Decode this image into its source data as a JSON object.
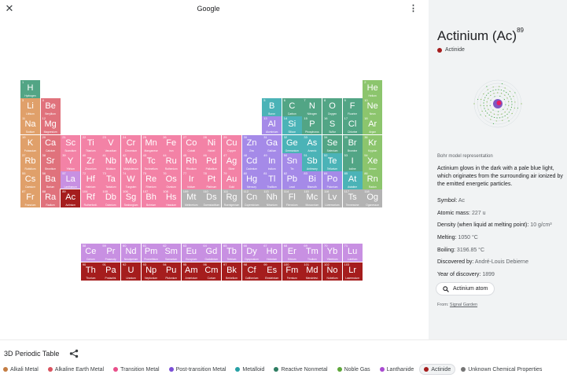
{
  "topbar": {
    "title": "Google"
  },
  "palette": {
    "alkali": "#e0a06a",
    "alkaline": "#e0727c",
    "transition": "#f382a6",
    "post": "#a58ae8",
    "metalloid": "#4bb3b7",
    "nonmetal": "#52a585",
    "noble": "#8cc56d",
    "lanthanide": "#c890e2",
    "actinide": "#a51d1d",
    "unknown": "#b3b3b3"
  },
  "elements": [
    {
      "n": "1",
      "s": "H",
      "name": "Hydrogen",
      "c": "nonmetal",
      "p": 1,
      "g": 1
    },
    {
      "n": "2",
      "s": "He",
      "name": "Helium",
      "c": "noble",
      "p": 1,
      "g": 18
    },
    {
      "n": "3",
      "s": "Li",
      "name": "Lithium",
      "c": "alkali",
      "p": 2,
      "g": 1
    },
    {
      "n": "4",
      "s": "Be",
      "name": "Beryllium",
      "c": "alkaline",
      "p": 2,
      "g": 2
    },
    {
      "n": "5",
      "s": "B",
      "name": "Boron",
      "c": "metalloid",
      "p": 2,
      "g": 13
    },
    {
      "n": "6",
      "s": "C",
      "name": "Carbon",
      "c": "nonmetal",
      "p": 2,
      "g": 14
    },
    {
      "n": "7",
      "s": "N",
      "name": "Nitrogen",
      "c": "nonmetal",
      "p": 2,
      "g": 15
    },
    {
      "n": "8",
      "s": "O",
      "name": "Oxygen",
      "c": "nonmetal",
      "p": 2,
      "g": 16
    },
    {
      "n": "9",
      "s": "F",
      "name": "Fluorine",
      "c": "nonmetal",
      "p": 2,
      "g": 17
    },
    {
      "n": "10",
      "s": "Ne",
      "name": "Neon",
      "c": "noble",
      "p": 2,
      "g": 18
    },
    {
      "n": "11",
      "s": "Na",
      "name": "Sodium",
      "c": "alkali",
      "p": 3,
      "g": 1
    },
    {
      "n": "12",
      "s": "Mg",
      "name": "Magnesium",
      "c": "alkaline",
      "p": 3,
      "g": 2
    },
    {
      "n": "13",
      "s": "Al",
      "name": "Aluminium",
      "c": "post",
      "p": 3,
      "g": 13
    },
    {
      "n": "14",
      "s": "Si",
      "name": "Silicon",
      "c": "metalloid",
      "p": 3,
      "g": 14
    },
    {
      "n": "15",
      "s": "P",
      "name": "Phosphorus",
      "c": "nonmetal",
      "p": 3,
      "g": 15
    },
    {
      "n": "16",
      "s": "S",
      "name": "Sulfur",
      "c": "nonmetal",
      "p": 3,
      "g": 16
    },
    {
      "n": "17",
      "s": "Cl",
      "name": "Chlorine",
      "c": "nonmetal",
      "p": 3,
      "g": 17
    },
    {
      "n": "18",
      "s": "Ar",
      "name": "Argon",
      "c": "noble",
      "p": 3,
      "g": 18
    },
    {
      "n": "19",
      "s": "K",
      "name": "Potassium",
      "c": "alkali",
      "p": 4,
      "g": 1
    },
    {
      "n": "20",
      "s": "Ca",
      "name": "Calcium",
      "c": "alkaline",
      "p": 4,
      "g": 2
    },
    {
      "n": "21",
      "s": "Sc",
      "name": "Scandium",
      "c": "transition",
      "p": 4,
      "g": 3
    },
    {
      "n": "22",
      "s": "Ti",
      "name": "Titanium",
      "c": "transition",
      "p": 4,
      "g": 4
    },
    {
      "n": "23",
      "s": "V",
      "name": "Vanadium",
      "c": "transition",
      "p": 4,
      "g": 5
    },
    {
      "n": "24",
      "s": "Cr",
      "name": "Chromium",
      "c": "transition",
      "p": 4,
      "g": 6
    },
    {
      "n": "25",
      "s": "Mn",
      "name": "Manganese",
      "c": "transition",
      "p": 4,
      "g": 7
    },
    {
      "n": "26",
      "s": "Fe",
      "name": "Iron",
      "c": "transition",
      "p": 4,
      "g": 8
    },
    {
      "n": "27",
      "s": "Co",
      "name": "Cobalt",
      "c": "transition",
      "p": 4,
      "g": 9
    },
    {
      "n": "28",
      "s": "Ni",
      "name": "Nickel",
      "c": "transition",
      "p": 4,
      "g": 10
    },
    {
      "n": "29",
      "s": "Cu",
      "name": "Copper",
      "c": "transition",
      "p": 4,
      "g": 11
    },
    {
      "n": "30",
      "s": "Zn",
      "name": "Zinc",
      "c": "post",
      "p": 4,
      "g": 12
    },
    {
      "n": "31",
      "s": "Ga",
      "name": "Gallium",
      "c": "post",
      "p": 4,
      "g": 13
    },
    {
      "n": "32",
      "s": "Ge",
      "name": "Germanium",
      "c": "metalloid",
      "p": 4,
      "g": 14
    },
    {
      "n": "33",
      "s": "As",
      "name": "Arsenic",
      "c": "metalloid",
      "p": 4,
      "g": 15
    },
    {
      "n": "34",
      "s": "Se",
      "name": "Selenium",
      "c": "nonmetal",
      "p": 4,
      "g": 16
    },
    {
      "n": "35",
      "s": "Br",
      "name": "Bromine",
      "c": "nonmetal",
      "p": 4,
      "g": 17
    },
    {
      "n": "36",
      "s": "Kr",
      "name": "Krypton",
      "c": "noble",
      "p": 4,
      "g": 18
    },
    {
      "n": "37",
      "s": "Rb",
      "name": "Rubidium",
      "c": "alkali",
      "p": 5,
      "g": 1
    },
    {
      "n": "38",
      "s": "Sr",
      "name": "Strontium",
      "c": "alkaline",
      "p": 5,
      "g": 2
    },
    {
      "n": "39",
      "s": "Y",
      "name": "Yttrium",
      "c": "transition",
      "p": 5,
      "g": 3
    },
    {
      "n": "40",
      "s": "Zr",
      "name": "Zirconium",
      "c": "transition",
      "p": 5,
      "g": 4
    },
    {
      "n": "41",
      "s": "Nb",
      "name": "Niobium",
      "c": "transition",
      "p": 5,
      "g": 5
    },
    {
      "n": "42",
      "s": "Mo",
      "name": "Molybdenum",
      "c": "transition",
      "p": 5,
      "g": 6
    },
    {
      "n": "43",
      "s": "Tc",
      "name": "Technetium",
      "c": "transition",
      "p": 5,
      "g": 7
    },
    {
      "n": "44",
      "s": "Ru",
      "name": "Ruthenium",
      "c": "transition",
      "p": 5,
      "g": 8
    },
    {
      "n": "45",
      "s": "Rh",
      "name": "Rhodium",
      "c": "transition",
      "p": 5,
      "g": 9
    },
    {
      "n": "46",
      "s": "Pd",
      "name": "Palladium",
      "c": "transition",
      "p": 5,
      "g": 10
    },
    {
      "n": "47",
      "s": "Ag",
      "name": "Silver",
      "c": "transition",
      "p": 5,
      "g": 11
    },
    {
      "n": "48",
      "s": "Cd",
      "name": "Cadmium",
      "c": "post",
      "p": 5,
      "g": 12
    },
    {
      "n": "49",
      "s": "In",
      "name": "Indium",
      "c": "post",
      "p": 5,
      "g": 13
    },
    {
      "n": "50",
      "s": "Sn",
      "name": "Tin",
      "c": "post",
      "p": 5,
      "g": 14
    },
    {
      "n": "51",
      "s": "Sb",
      "name": "Antimony",
      "c": "metalloid",
      "p": 5,
      "g": 15
    },
    {
      "n": "52",
      "s": "Te",
      "name": "Tellurium",
      "c": "metalloid",
      "p": 5,
      "g": 16
    },
    {
      "n": "53",
      "s": "I",
      "name": "Iodine",
      "c": "nonmetal",
      "p": 5,
      "g": 17
    },
    {
      "n": "54",
      "s": "Xe",
      "name": "Xenon",
      "c": "noble",
      "p": 5,
      "g": 18
    },
    {
      "n": "55",
      "s": "Cs",
      "name": "Caesium",
      "c": "alkali",
      "p": 6,
      "g": 1
    },
    {
      "n": "56",
      "s": "Ba",
      "name": "Barium",
      "c": "alkaline",
      "p": 6,
      "g": 2
    },
    {
      "n": "57",
      "s": "La",
      "name": "Lanthanum",
      "c": "lanthanide",
      "p": 6,
      "g": 3
    },
    {
      "n": "72",
      "s": "Hf",
      "name": "Hafnium",
      "c": "transition",
      "p": 6,
      "g": 4
    },
    {
      "n": "73",
      "s": "Ta",
      "name": "Tantalum",
      "c": "transition",
      "p": 6,
      "g": 5
    },
    {
      "n": "74",
      "s": "W",
      "name": "Tungsten",
      "c": "transition",
      "p": 6,
      "g": 6
    },
    {
      "n": "75",
      "s": "Re",
      "name": "Rhenium",
      "c": "transition",
      "p": 6,
      "g": 7
    },
    {
      "n": "76",
      "s": "Os",
      "name": "Osmium",
      "c": "transition",
      "p": 6,
      "g": 8
    },
    {
      "n": "77",
      "s": "Ir",
      "name": "Iridium",
      "c": "transition",
      "p": 6,
      "g": 9
    },
    {
      "n": "78",
      "s": "Pt",
      "name": "Platinum",
      "c": "transition",
      "p": 6,
      "g": 10
    },
    {
      "n": "79",
      "s": "Au",
      "name": "Gold",
      "c": "transition",
      "p": 6,
      "g": 11
    },
    {
      "n": "80",
      "s": "Hg",
      "name": "Mercury",
      "c": "post",
      "p": 6,
      "g": 12
    },
    {
      "n": "81",
      "s": "Tl",
      "name": "Thallium",
      "c": "post",
      "p": 6,
      "g": 13
    },
    {
      "n": "82",
      "s": "Pb",
      "name": "Lead",
      "c": "post",
      "p": 6,
      "g": 14
    },
    {
      "n": "83",
      "s": "Bi",
      "name": "Bismuth",
      "c": "post",
      "p": 6,
      "g": 15
    },
    {
      "n": "84",
      "s": "Po",
      "name": "Polonium",
      "c": "post",
      "p": 6,
      "g": 16
    },
    {
      "n": "85",
      "s": "At",
      "name": "Astatine",
      "c": "metalloid",
      "p": 6,
      "g": 17
    },
    {
      "n": "86",
      "s": "Rn",
      "name": "Radon",
      "c": "noble",
      "p": 6,
      "g": 18
    },
    {
      "n": "87",
      "s": "Fr",
      "name": "Francium",
      "c": "alkali",
      "p": 7,
      "g": 1
    },
    {
      "n": "88",
      "s": "Ra",
      "name": "Radium",
      "c": "alkaline",
      "p": 7,
      "g": 2
    },
    {
      "n": "89",
      "s": "Ac",
      "name": "Actinium",
      "c": "actinide",
      "p": 7,
      "g": 3
    },
    {
      "n": "104",
      "s": "Rf",
      "name": "Rutherfordi.",
      "c": "transition",
      "p": 7,
      "g": 4
    },
    {
      "n": "105",
      "s": "Db",
      "name": "Dubnium",
      "c": "transition",
      "p": 7,
      "g": 5
    },
    {
      "n": "106",
      "s": "Sg",
      "name": "Seaborgium",
      "c": "transition",
      "p": 7,
      "g": 6
    },
    {
      "n": "107",
      "s": "Bh",
      "name": "Bohrium",
      "c": "transition",
      "p": 7,
      "g": 7
    },
    {
      "n": "108",
      "s": "Hs",
      "name": "Hassium",
      "c": "transition",
      "p": 7,
      "g": 8
    },
    {
      "n": "109",
      "s": "Mt",
      "name": "Meitnerium",
      "c": "unknown",
      "p": 7,
      "g": 9
    },
    {
      "n": "110",
      "s": "Ds",
      "name": "Darmstadtium",
      "c": "unknown",
      "p": 7,
      "g": 10
    },
    {
      "n": "111",
      "s": "Rg",
      "name": "Roentgenium",
      "c": "unknown",
      "p": 7,
      "g": 11
    },
    {
      "n": "112",
      "s": "Cn",
      "name": "Copernicium",
      "c": "unknown",
      "p": 7,
      "g": 12
    },
    {
      "n": "113",
      "s": "Nh",
      "name": "Nihonium",
      "c": "unknown",
      "p": 7,
      "g": 13
    },
    {
      "n": "114",
      "s": "Fl",
      "name": "Flerovium",
      "c": "unknown",
      "p": 7,
      "g": 14
    },
    {
      "n": "115",
      "s": "Mc",
      "name": "Moscovium",
      "c": "unknown",
      "p": 7,
      "g": 15
    },
    {
      "n": "116",
      "s": "Lv",
      "name": "Livermorium",
      "c": "unknown",
      "p": 7,
      "g": 16
    },
    {
      "n": "117",
      "s": "Ts",
      "name": "Tennessine",
      "c": "unknown",
      "p": 7,
      "g": 17
    },
    {
      "n": "118",
      "s": "Og",
      "name": "Oganesson",
      "c": "unknown",
      "p": 7,
      "g": 18
    },
    {
      "n": "58",
      "s": "Ce",
      "name": "Cerium",
      "c": "lanthanide",
      "p": 9,
      "g": 4
    },
    {
      "n": "59",
      "s": "Pr",
      "name": "Praseody.",
      "c": "lanthanide",
      "p": 9,
      "g": 5
    },
    {
      "n": "60",
      "s": "Nd",
      "name": "Neodymium",
      "c": "lanthanide",
      "p": 9,
      "g": 6
    },
    {
      "n": "61",
      "s": "Pm",
      "name": "Promethium",
      "c": "lanthanide",
      "p": 9,
      "g": 7
    },
    {
      "n": "62",
      "s": "Sm",
      "name": "Samarium",
      "c": "lanthanide",
      "p": 9,
      "g": 8
    },
    {
      "n": "63",
      "s": "Eu",
      "name": "Europium",
      "c": "lanthanide",
      "p": 9,
      "g": 9
    },
    {
      "n": "64",
      "s": "Gd",
      "name": "Gadolinium",
      "c": "lanthanide",
      "p": 9,
      "g": 10
    },
    {
      "n": "65",
      "s": "Tb",
      "name": "Terbium",
      "c": "lanthanide",
      "p": 9,
      "g": 11
    },
    {
      "n": "66",
      "s": "Dy",
      "name": "Dysprosium",
      "c": "lanthanide",
      "p": 9,
      "g": 12
    },
    {
      "n": "67",
      "s": "Ho",
      "name": "Holmium",
      "c": "lanthanide",
      "p": 9,
      "g": 13
    },
    {
      "n": "68",
      "s": "Er",
      "name": "Erbium",
      "c": "lanthanide",
      "p": 9,
      "g": 14
    },
    {
      "n": "69",
      "s": "Tm",
      "name": "Thulium",
      "c": "lanthanide",
      "p": 9,
      "g": 15
    },
    {
      "n": "70",
      "s": "Yb",
      "name": "Ytterbium",
      "c": "lanthanide",
      "p": 9,
      "g": 16
    },
    {
      "n": "71",
      "s": "Lu",
      "name": "Lutetium",
      "c": "lanthanide",
      "p": 9,
      "g": 17
    },
    {
      "n": "90",
      "s": "Th",
      "name": "Thorium",
      "c": "actinide",
      "p": 10,
      "g": 4
    },
    {
      "n": "91",
      "s": "Pa",
      "name": "Protactini.",
      "c": "actinide",
      "p": 10,
      "g": 5
    },
    {
      "n": "92",
      "s": "U",
      "name": "Uranium",
      "c": "actinide",
      "p": 10,
      "g": 6
    },
    {
      "n": "93",
      "s": "Np",
      "name": "Neptunium",
      "c": "actinide",
      "p": 10,
      "g": 7
    },
    {
      "n": "94",
      "s": "Pu",
      "name": "Plutonium",
      "c": "actinide",
      "p": 10,
      "g": 8
    },
    {
      "n": "95",
      "s": "Am",
      "name": "Americium",
      "c": "actinide",
      "p": 10,
      "g": 9
    },
    {
      "n": "96",
      "s": "Cm",
      "name": "Curium",
      "c": "actinide",
      "p": 10,
      "g": 10
    },
    {
      "n": "97",
      "s": "Bk",
      "name": "Berkelium",
      "c": "actinide",
      "p": 10,
      "g": 11
    },
    {
      "n": "98",
      "s": "Cf",
      "name": "Californium",
      "c": "actinide",
      "p": 10,
      "g": 12
    },
    {
      "n": "99",
      "s": "Es",
      "name": "Einsteinium",
      "c": "actinide",
      "p": 10,
      "g": 13
    },
    {
      "n": "100",
      "s": "Fm",
      "name": "Fermium",
      "c": "actinide",
      "p": 10,
      "g": 14
    },
    {
      "n": "101",
      "s": "Md",
      "name": "Mendelevi.",
      "c": "actinide",
      "p": 10,
      "g": 15
    },
    {
      "n": "102",
      "s": "No",
      "name": "Nobelium",
      "c": "actinide",
      "p": 10,
      "g": 16
    },
    {
      "n": "103",
      "s": "Lr",
      "name": "Lawrencium",
      "c": "actinide",
      "p": 10,
      "g": 17
    }
  ],
  "selected_element": "89",
  "panel": {
    "title": "Actinium (Ac)",
    "atomic_number": "89",
    "category": "Actinide",
    "image_caption": "Bohr model representation",
    "description": "Actinium glows in the dark with a pale blue light, which originates from the surrounding air ionized by the emitted energetic particles.",
    "symbol_label": "Symbol:",
    "symbol_value": "Ac",
    "mass_label": "Atomic mass:",
    "mass_value": "227 u",
    "density_label": "Density (when liquid at melting point):",
    "density_value": "10 g/cm³",
    "melting_label": "Melting:",
    "melting_value": "1050 °C",
    "boiling_label": "Boiling:",
    "boiling_value": "3196.85 °C",
    "discovered_label": "Discovered by:",
    "discovered_value": "André-Louis Debierne",
    "year_label": "Year of discovery:",
    "year_value": "1899",
    "chip_label": "Actinium atom",
    "from_label": "From:",
    "from_source": "Signal Garden"
  },
  "bottom": {
    "title": "3D Periodic Table",
    "legend": [
      {
        "key": "alkali",
        "label": "Alkali Metal",
        "color": "#c47d43"
      },
      {
        "key": "alkaline",
        "label": "Alkaline Earth Metal",
        "color": "#d9535f"
      },
      {
        "key": "transition",
        "label": "Transition Metal",
        "color": "#e94f8a"
      },
      {
        "key": "post",
        "label": "Post-transition Metal",
        "color": "#7b4fd6"
      },
      {
        "key": "metalloid",
        "label": "Metalloid",
        "color": "#26a0a5"
      },
      {
        "key": "nonmetal",
        "label": "Reactive Nonmetal",
        "color": "#2e7d62"
      },
      {
        "key": "noble",
        "label": "Noble Gas",
        "color": "#5ea73a"
      },
      {
        "key": "lanthanide",
        "label": "Lanthanide",
        "color": "#a94bd1"
      },
      {
        "key": "actinide",
        "label": "Actinide",
        "color": "#a51d1d"
      },
      {
        "key": "unknown",
        "label": "Unknown Chemical Properties",
        "color": "#757575"
      }
    ],
    "active_legend": "actinide"
  }
}
